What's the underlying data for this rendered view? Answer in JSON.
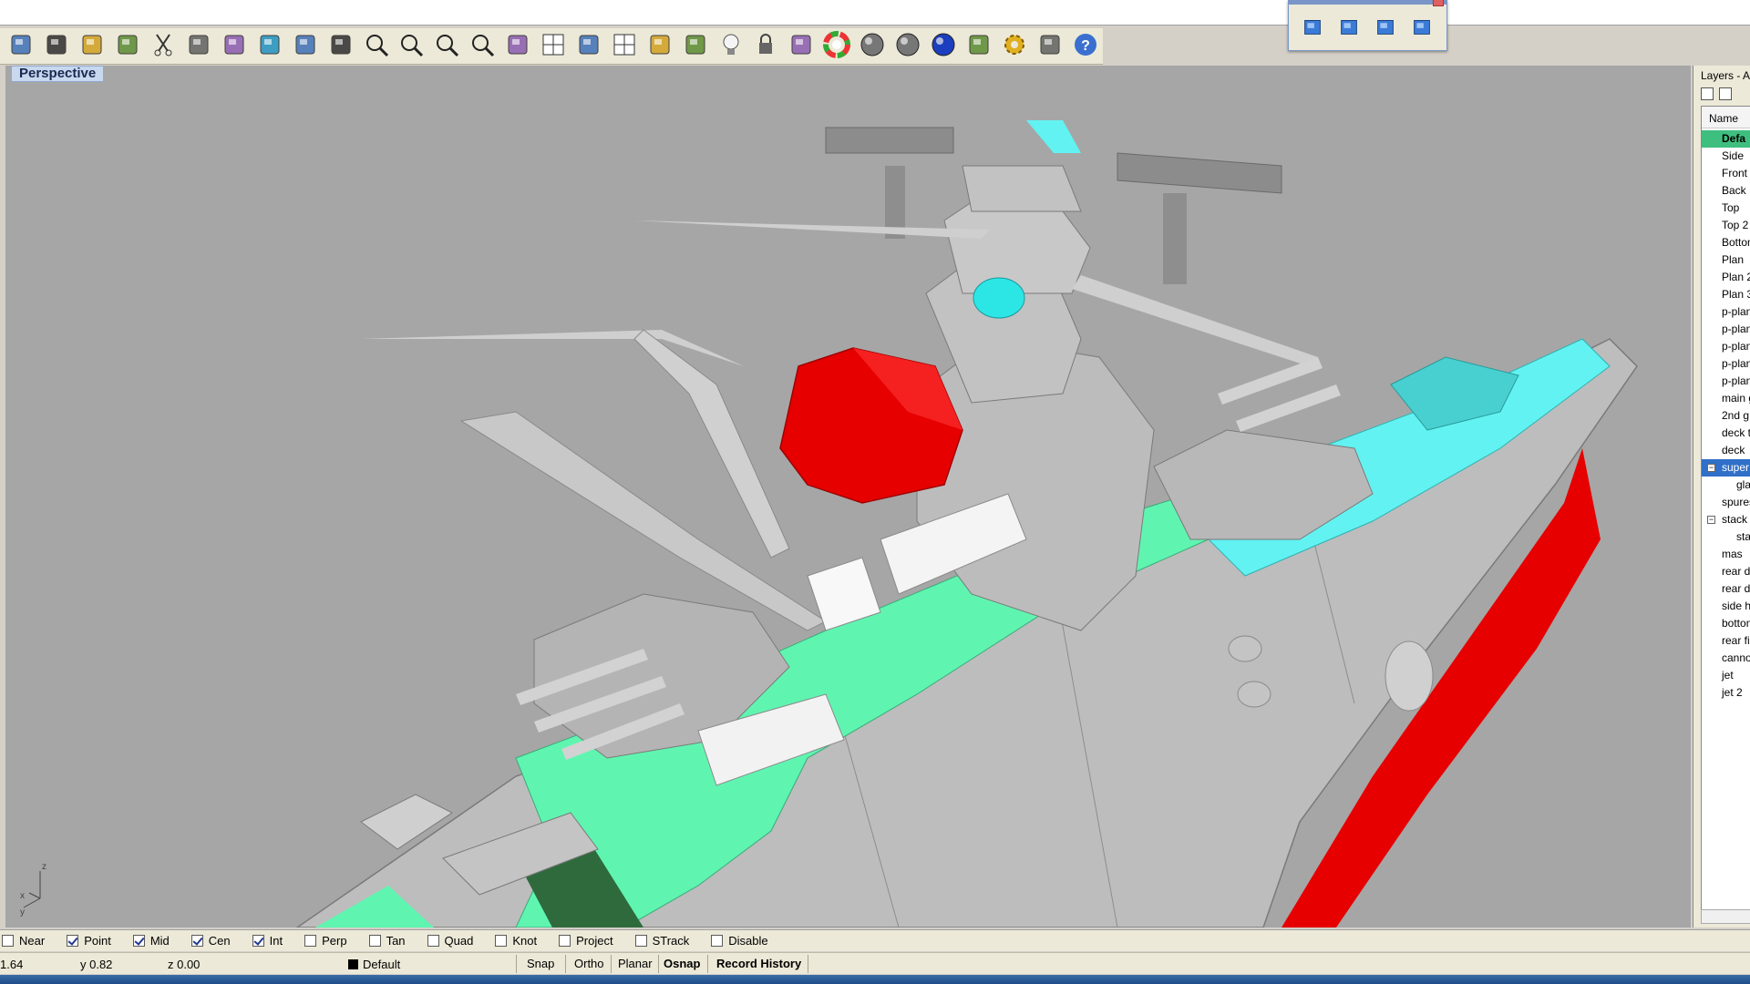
{
  "toolbar": {
    "icons": [
      "new-file-icon",
      "save-icon",
      "print-icon",
      "import-icon",
      "cut-icon",
      "copy-icon",
      "paste-icon",
      "undo-icon",
      "pan-hand-icon",
      "rotate-view-icon",
      "zoom-dynamic-icon",
      "zoom-window-icon",
      "zoom-extents-icon",
      "zoom-selected-icon",
      "undo-view-icon",
      "four-viewports-icon",
      "car-named-view-icon",
      "grid-plane-icon",
      "circle-snap-icon",
      "gumball-icon",
      "lightbulb-icon",
      "lock-icon",
      "layer-book-icon",
      "color-wheel-icon",
      "shaded-sphere-icon",
      "rendered-sphere-icon",
      "render-sphere-icon",
      "flag-icon",
      "gear-options-icon",
      "expand-icon",
      "help-icon"
    ]
  },
  "float_palette": {
    "icons": [
      "perspective-view-icon",
      "top-view-icon",
      "front-view-icon",
      "right-view-icon"
    ]
  },
  "viewport": {
    "label": "Perspective",
    "axis_labels": {
      "x": "x",
      "y": "y",
      "z": "z"
    },
    "colors": {
      "background": "#a6a6a6",
      "selected_red": "#e60000",
      "cyan": "#62f2f2",
      "mint": "#5ff5b0",
      "dark_green": "#2f6a3c"
    }
  },
  "layers_panel": {
    "title": "Layers - A",
    "column_header": "Name",
    "items": [
      {
        "label": "Defa",
        "state": "current"
      },
      {
        "label": "Side"
      },
      {
        "label": "Front"
      },
      {
        "label": "Back"
      },
      {
        "label": "Top"
      },
      {
        "label": "Top 2"
      },
      {
        "label": "Bottom"
      },
      {
        "label": "Plan"
      },
      {
        "label": "Plan 2"
      },
      {
        "label": "Plan 3"
      },
      {
        "label": "p-plan"
      },
      {
        "label": "p-plan"
      },
      {
        "label": "p-plan"
      },
      {
        "label": "p-plan"
      },
      {
        "label": "p-plan"
      },
      {
        "label": "main g"
      },
      {
        "label": "2nd g"
      },
      {
        "label": "deck t"
      },
      {
        "label": "deck"
      },
      {
        "label": "super",
        "state": "selected",
        "toggle": "−"
      },
      {
        "label": "gla",
        "sub": true
      },
      {
        "label": "spures"
      },
      {
        "label": "stack",
        "toggle": "−"
      },
      {
        "label": "sta",
        "sub": true
      },
      {
        "label": "mas"
      },
      {
        "label": "rear d"
      },
      {
        "label": "rear d"
      },
      {
        "label": "side h"
      },
      {
        "label": "bottom"
      },
      {
        "label": "rear fi"
      },
      {
        "label": "canno"
      },
      {
        "label": "jet"
      },
      {
        "label": "jet 2"
      }
    ]
  },
  "osnap": {
    "items": [
      {
        "label": "Near",
        "checked": false
      },
      {
        "label": "Point",
        "checked": true
      },
      {
        "label": "Mid",
        "checked": true
      },
      {
        "label": "Cen",
        "checked": true
      },
      {
        "label": "Int",
        "checked": true
      },
      {
        "label": "Perp",
        "checked": false
      },
      {
        "label": "Tan",
        "checked": false
      },
      {
        "label": "Quad",
        "checked": false
      },
      {
        "label": "Knot",
        "checked": false
      },
      {
        "label": "Project",
        "checked": false
      },
      {
        "label": "STrack",
        "checked": false
      },
      {
        "label": "Disable",
        "checked": false
      }
    ]
  },
  "status_bar": {
    "x": "1.64",
    "y": "y 0.82",
    "z": "z 0.00",
    "layer": "Default",
    "panes": [
      "Snap",
      "Ortho",
      "Planar",
      "Osnap",
      "Record History"
    ]
  }
}
